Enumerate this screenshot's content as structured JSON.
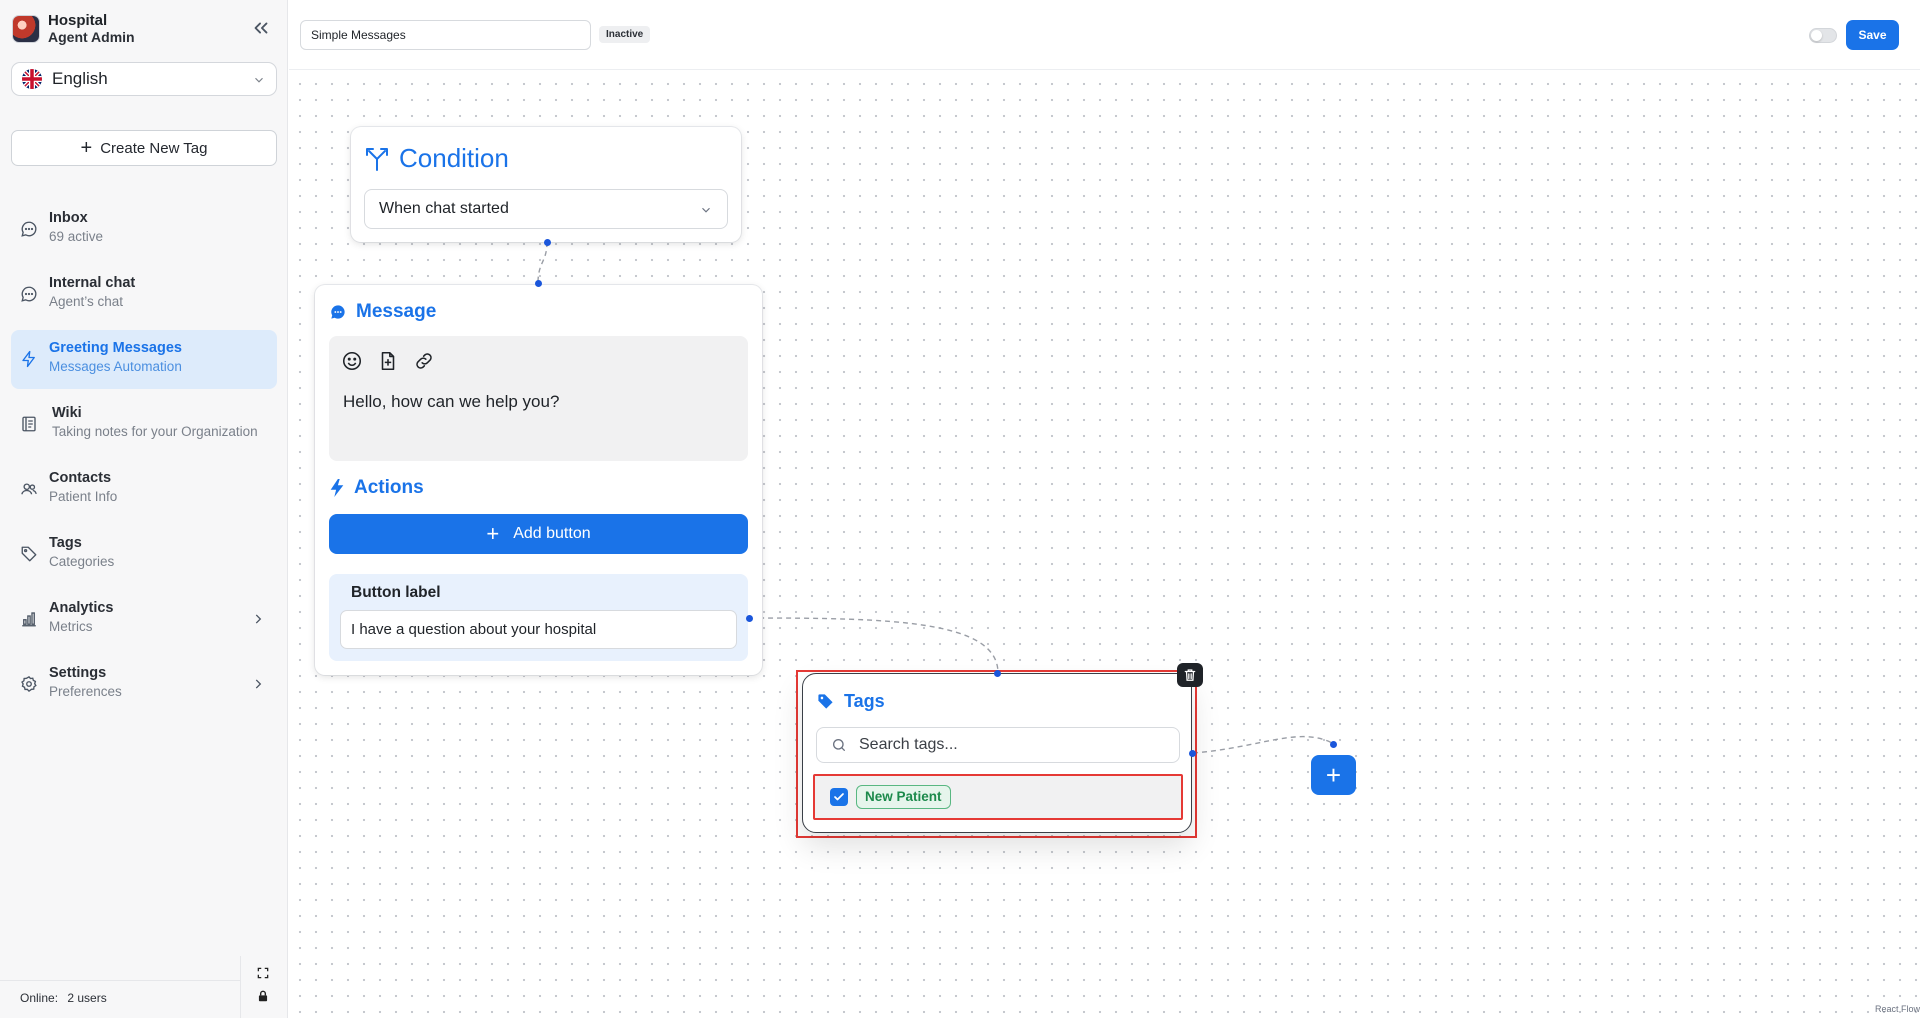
{
  "brand": {
    "name": "Hospital",
    "subtitle": "Agent Admin"
  },
  "language": {
    "selected": "English"
  },
  "sidebar": {
    "create_label": "Create New Tag",
    "items": [
      {
        "title": "Inbox",
        "subtitle": "69 active",
        "icon": "chat-bubble-icon"
      },
      {
        "title": "Internal chat",
        "subtitle": "Agent’s chat",
        "icon": "chat-bubble-icon"
      },
      {
        "title": "Greeting Messages",
        "subtitle": "Messages Automation",
        "icon": "lightning-icon",
        "active": true
      },
      {
        "title": "Wiki",
        "subtitle": "Taking notes for your Organization",
        "icon": "book-icon"
      },
      {
        "title": "Contacts",
        "subtitle": "Patient Info",
        "icon": "users-icon"
      },
      {
        "title": "Tags",
        "subtitle": "Categories",
        "icon": "tag-icon"
      },
      {
        "title": "Analytics",
        "subtitle": "Metrics",
        "icon": "bar-chart-icon",
        "has_submenu": true
      },
      {
        "title": "Settings",
        "subtitle": "Preferences",
        "icon": "gear-icon",
        "has_submenu": true
      }
    ],
    "online_label": "Online:",
    "online_count": "2 users"
  },
  "topbar": {
    "flow_name": "Simple Messages",
    "status": "Inactive",
    "active_toggle": false,
    "save_label": "Save"
  },
  "nodes": {
    "condition": {
      "title": "Condition",
      "trigger": "When chat started"
    },
    "message": {
      "title": "Message",
      "text": "Hello, how can we help you?",
      "actions_title": "Actions",
      "add_button_label": "Add button",
      "button_label_title": "Button label",
      "button_label_value": "I have a question about your hospital"
    },
    "tags": {
      "title": "Tags",
      "search_placeholder": "Search tags...",
      "items": [
        {
          "label": "New Patient",
          "checked": true
        }
      ]
    }
  },
  "attribution": "React Flow",
  "colors": {
    "accent": "#1a73e8",
    "selection": "#e53935",
    "tag_green": "#1d8a4c"
  }
}
